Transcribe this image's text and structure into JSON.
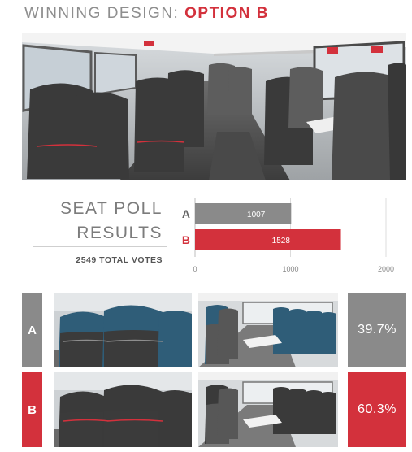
{
  "header": {
    "title_lead": "WINNING DESIGN: ",
    "title_accent": "OPTION B"
  },
  "poll": {
    "title_line1": "SEAT POLL",
    "title_line2": "RESULTS",
    "total_votes": "2549 TOTAL VOTES"
  },
  "chart_data": {
    "type": "bar",
    "orientation": "horizontal",
    "categories": [
      "A",
      "B"
    ],
    "values": [
      1007,
      1528
    ],
    "value_labels": [
      "1007",
      "1528"
    ],
    "colors": [
      "#8a8a8a",
      "#d3313c"
    ],
    "xlim": [
      0,
      2000
    ],
    "xticks": [
      "0",
      "1000",
      "2000"
    ],
    "grid": true
  },
  "options": [
    {
      "label": "A",
      "percent": "39.7%",
      "color": "#8a8a8a",
      "headrest": "#2f5d78"
    },
    {
      "label": "B",
      "percent": "60.3%",
      "color": "#d3313c",
      "headrest": "#3a3a3a"
    }
  ]
}
